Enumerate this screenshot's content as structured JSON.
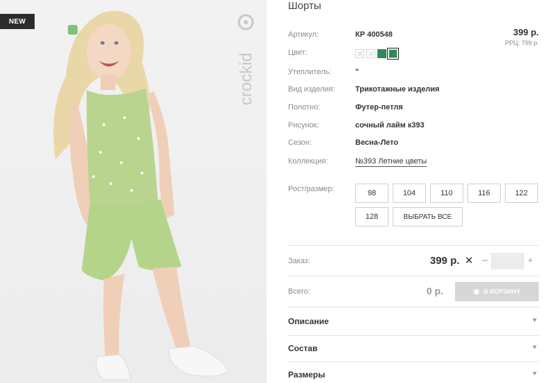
{
  "badge": "NEW",
  "brand": "crockid",
  "product": {
    "title": "Шорты",
    "price": "399 р.",
    "rrc": "РРЦ: 799 р.",
    "attributes": {
      "article_label": "Артикул:",
      "article_value": "КР 400548",
      "color_label": "Цвет:",
      "insulation_label": "Утеплитель:",
      "insulation_value": "\"",
      "type_label": "Вид изделия:",
      "type_value": "Трикотажные изделия",
      "fabric_label": "Полотно:",
      "fabric_value": "Футер-петля",
      "pattern_label": "Рисунок:",
      "pattern_value": "сочный лайм к393",
      "season_label": "Сезон:",
      "season_value": "Весна-Лето",
      "collection_label": "Коллекция:",
      "collection_value": "№393 Летние цветы"
    },
    "colors": {
      "swatches": [
        "disabled",
        "disabled",
        "green",
        "green-selected"
      ],
      "accent": "#2e8b57"
    },
    "sizes": {
      "label": "Рост/размер:",
      "options": [
        "98",
        "104",
        "110",
        "116",
        "122",
        "128"
      ],
      "select_all": "ВЫБРАТЬ ВСЕ"
    },
    "order": {
      "label": "Заказ:",
      "price": "399 р.",
      "remove": "✕",
      "minus": "–",
      "plus": "+",
      "qty": ""
    },
    "total": {
      "label": "Всего:",
      "value": "0 р.",
      "cart_button": "В КОРЗИНУ"
    },
    "accordion": [
      "Описание",
      "Состав",
      "Размеры"
    ]
  }
}
